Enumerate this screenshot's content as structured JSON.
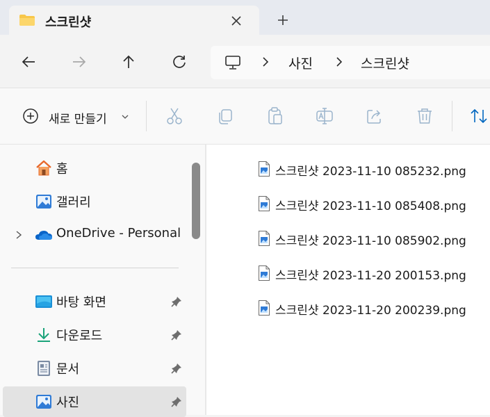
{
  "tab": {
    "title": "스크린샷"
  },
  "address": {
    "segments": [
      "사진",
      "스크린샷"
    ]
  },
  "command_bar": {
    "new_label": "새로 만들기"
  },
  "sidebar": {
    "items": [
      {
        "label": "홈",
        "icon": "home-icon"
      },
      {
        "label": "갤러리",
        "icon": "gallery-icon"
      },
      {
        "label": "OneDrive - Personal",
        "icon": "onedrive-cloud-icon"
      },
      {
        "label": "바탕 화면",
        "icon": "desktop-icon"
      },
      {
        "label": "다운로드",
        "icon": "download-icon"
      },
      {
        "label": "문서",
        "icon": "documents-icon"
      },
      {
        "label": "사진",
        "icon": "pictures-icon",
        "selected": true
      }
    ]
  },
  "files": [
    {
      "name": "스크린샷 2023-11-10 085232.png"
    },
    {
      "name": "스크린샷 2023-11-10 085408.png"
    },
    {
      "name": "스크린샷 2023-11-10 085902.png"
    },
    {
      "name": "스크린샷 2023-11-20 200153.png"
    },
    {
      "name": "스크린샷 2023-11-20 200239.png"
    }
  ],
  "colors": {
    "accent": "#0067c0",
    "folder": "#f8c74a",
    "disabled_icon": "#9ab4cc"
  }
}
